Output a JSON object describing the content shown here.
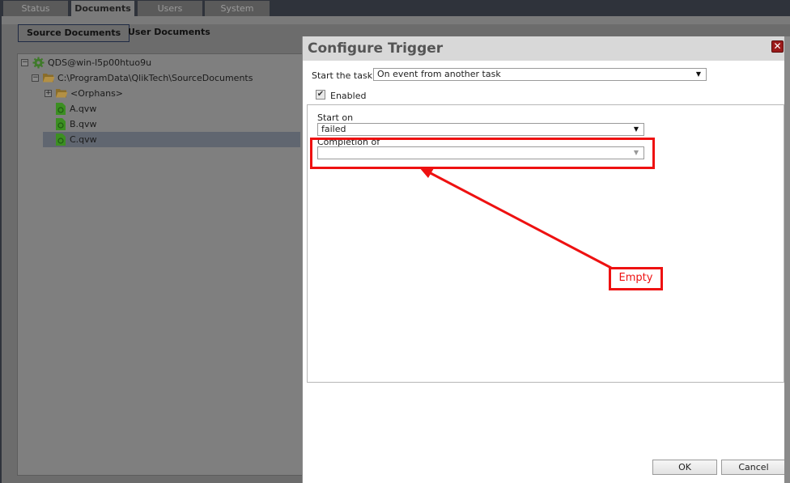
{
  "main_tabs": [
    {
      "label": "Status",
      "active": false
    },
    {
      "label": "Documents",
      "active": true
    },
    {
      "label": "Users",
      "active": false
    },
    {
      "label": "System",
      "active": false
    }
  ],
  "sub_tabs": [
    {
      "label": "Source Documents",
      "active": true
    },
    {
      "label": "User Documents",
      "active": false
    }
  ],
  "tree": {
    "server": {
      "label": "QDS@win-l5p00htuo9u",
      "icon": "gear-icon",
      "expanded": true
    },
    "folder": {
      "label": "C:\\ProgramData\\QlikTech\\SourceDocuments",
      "icon": "folder-icon",
      "expanded": true
    },
    "orphans": {
      "label": "<Orphans>",
      "icon": "folder-icon",
      "expanded": false
    },
    "documents": [
      {
        "label": "A.qvw",
        "selected": false
      },
      {
        "label": "B.qvw",
        "selected": false
      },
      {
        "label": "C.qvw",
        "selected": true
      }
    ]
  },
  "dialog": {
    "title": "Configure Trigger",
    "close_glyph": "✕",
    "start_task_label": "Start the task",
    "start_task_value": "On event from another task",
    "enabled_label": "Enabled",
    "enabled_checked": true,
    "checkmark": "✔",
    "start_on_label": "Start on",
    "start_on_value": "failed",
    "completion_of_label": "Completion of",
    "completion_of_value": "",
    "dropdown_arrow": "▼",
    "ok_label": "OK",
    "cancel_label": "Cancel"
  },
  "annotation": {
    "label": "Empty",
    "color": "#ee1111"
  }
}
